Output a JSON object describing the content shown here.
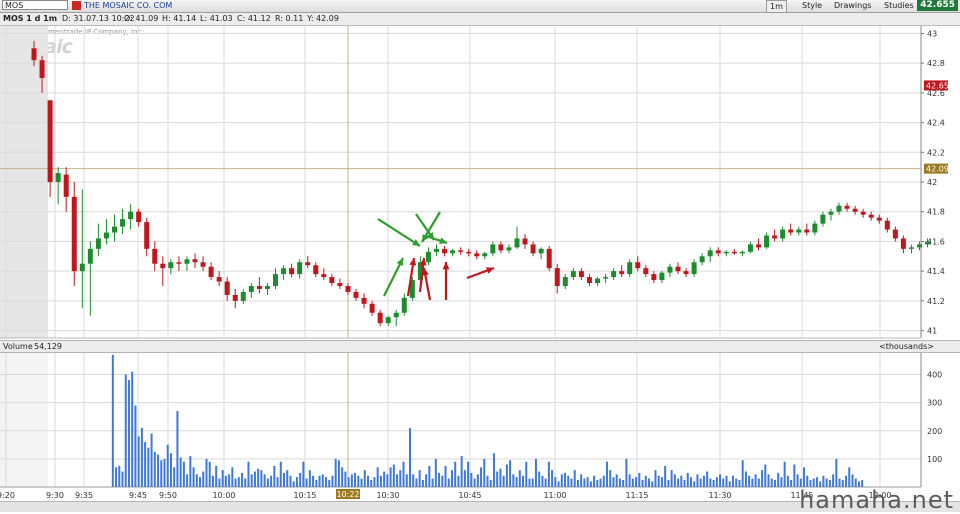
{
  "toolbar": {
    "symbol": "MOS",
    "company": "THE MOSAIC CO. COM",
    "interval": "1m",
    "style": "Style",
    "drawings": "Drawings",
    "studies": "Studies",
    "last_price": "42.655"
  },
  "info": {
    "chart_label": "MOS 1 d 1m",
    "date": "D: 31.07.13 10:22",
    "open": "O: 41.09",
    "high": "H: 41.14",
    "low": "L: 41.03",
    "close": "C: 41.12",
    "range": "R: 0.11",
    "y": "Y: 42.09"
  },
  "watermark": {
    "copyright": "2013 © TD Ameritrade IP Company, Inc.",
    "logo": "Mosaic"
  },
  "volume_panel": {
    "label": "Volume",
    "value": "54,129",
    "units": "<thousands>"
  },
  "site_watermark": "hamaha.net",
  "colors": {
    "up": "#1e8c2e",
    "down": "#c0171d",
    "volume": "#3e78d8",
    "grid": "#d9d9d9",
    "crosshair": "#c8b48a",
    "arrow_green": "#2e9e2e",
    "arrow_red": "#c0171d"
  },
  "chart_data": [
    {
      "type": "candlestick",
      "title": "MOS 1 d 1m",
      "ylim": [
        40.95,
        43.05
      ],
      "y_ticks": [
        "43",
        "42.8",
        "42.6",
        "42.4",
        "42.2",
        "42",
        "41.8",
        "41.6",
        "41.4",
        "41.2",
        "41"
      ],
      "x_ticks": [
        "9:20",
        "9:30",
        "9:35",
        "9:45",
        "9:50",
        "10:00",
        "10:15",
        "10:30",
        "10:45",
        "11:00",
        "11:15",
        "11:30",
        "11:45",
        "12:00"
      ],
      "price_markers": [
        {
          "label": "42.65",
          "value": 42.65,
          "color": "#c0171d"
        },
        {
          "label": "42.09",
          "value": 42.09,
          "color": "#9b7a1e"
        }
      ],
      "crosshair": {
        "time": "10:22",
        "price": 42.09
      },
      "ohlc": [
        [
          42.9,
          42.95,
          42.78,
          42.82
        ],
        [
          42.82,
          42.85,
          42.6,
          42.7
        ],
        [
          42.55,
          42.55,
          41.9,
          42.0
        ],
        [
          42.0,
          42.1,
          41.85,
          42.06
        ],
        [
          42.05,
          42.1,
          41.8,
          41.9
        ],
        [
          41.9,
          42.0,
          41.3,
          41.4
        ],
        [
          41.4,
          41.95,
          41.15,
          41.45
        ],
        [
          41.45,
          41.6,
          41.1,
          41.55
        ],
        [
          41.55,
          41.72,
          41.5,
          41.62
        ],
        [
          41.62,
          41.75,
          41.58,
          41.66
        ],
        [
          41.66,
          41.78,
          41.6,
          41.7
        ],
        [
          41.7,
          41.82,
          41.65,
          41.75
        ],
        [
          41.75,
          41.85,
          41.68,
          41.8
        ],
        [
          41.8,
          41.82,
          41.7,
          41.73
        ],
        [
          41.73,
          41.76,
          41.5,
          41.55
        ],
        [
          41.55,
          41.6,
          41.4,
          41.45
        ],
        [
          41.45,
          41.5,
          41.3,
          41.42
        ],
        [
          41.42,
          41.48,
          41.38,
          41.46
        ],
        [
          41.46,
          41.5,
          41.4,
          41.45
        ],
        [
          41.45,
          41.5,
          41.4,
          41.48
        ],
        [
          41.48,
          41.52,
          41.42,
          41.46
        ],
        [
          41.46,
          41.5,
          41.4,
          41.43
        ],
        [
          41.43,
          41.46,
          41.34,
          41.36
        ],
        [
          41.36,
          41.4,
          41.3,
          41.33
        ],
        [
          41.33,
          41.36,
          41.2,
          41.24
        ],
        [
          41.24,
          41.28,
          41.15,
          41.2
        ],
        [
          41.2,
          41.28,
          41.18,
          41.26
        ],
        [
          41.26,
          41.32,
          41.22,
          41.3
        ],
        [
          41.3,
          41.36,
          41.25,
          41.28
        ],
        [
          41.28,
          41.32,
          41.24,
          41.3
        ],
        [
          41.3,
          41.42,
          41.28,
          41.38
        ],
        [
          41.38,
          41.44,
          41.34,
          41.42
        ],
        [
          41.42,
          41.45,
          41.36,
          41.38
        ],
        [
          41.38,
          41.48,
          41.35,
          41.46
        ],
        [
          41.46,
          41.5,
          41.42,
          41.44
        ],
        [
          41.44,
          41.46,
          41.36,
          41.38
        ],
        [
          41.38,
          41.42,
          41.34,
          41.36
        ],
        [
          41.36,
          41.38,
          41.3,
          41.32
        ],
        [
          41.32,
          41.35,
          41.28,
          41.3
        ],
        [
          41.3,
          41.32,
          41.24,
          41.26
        ],
        [
          41.26,
          41.28,
          41.2,
          41.22
        ],
        [
          41.22,
          41.25,
          41.15,
          41.18
        ],
        [
          41.18,
          41.2,
          41.1,
          41.12
        ],
        [
          41.12,
          41.14,
          41.03,
          41.05
        ],
        [
          41.05,
          41.1,
          41.03,
          41.09
        ],
        [
          41.09,
          41.14,
          41.03,
          41.12
        ],
        [
          41.12,
          41.25,
          41.1,
          41.22
        ],
        [
          41.22,
          41.36,
          41.2,
          41.34
        ],
        [
          41.34,
          41.5,
          41.32,
          41.46
        ],
        [
          41.46,
          41.56,
          41.44,
          41.53
        ],
        [
          41.53,
          41.58,
          41.5,
          41.55
        ],
        [
          41.55,
          41.57,
          41.5,
          41.52
        ],
        [
          41.52,
          41.55,
          41.5,
          41.54
        ],
        [
          41.54,
          41.56,
          41.51,
          41.53
        ],
        [
          41.53,
          41.55,
          41.5,
          41.52
        ],
        [
          41.52,
          41.54,
          41.48,
          41.5
        ],
        [
          41.5,
          41.53,
          41.48,
          41.52
        ],
        [
          41.52,
          41.6,
          41.5,
          41.58
        ],
        [
          41.58,
          41.6,
          41.52,
          41.54
        ],
        [
          41.54,
          41.58,
          41.52,
          41.56
        ],
        [
          41.56,
          41.7,
          41.55,
          41.62
        ],
        [
          41.62,
          41.65,
          41.55,
          41.58
        ],
        [
          41.58,
          41.6,
          41.5,
          41.52
        ],
        [
          41.52,
          41.56,
          41.48,
          41.55
        ],
        [
          41.55,
          41.57,
          41.4,
          41.42
        ],
        [
          41.42,
          41.45,
          41.25,
          41.3
        ],
        [
          41.3,
          41.38,
          41.28,
          41.36
        ],
        [
          41.36,
          41.42,
          41.34,
          41.4
        ],
        [
          41.4,
          41.42,
          41.34,
          41.36
        ],
        [
          41.36,
          41.38,
          41.3,
          41.32
        ],
        [
          41.32,
          41.36,
          41.3,
          41.35
        ],
        [
          41.35,
          41.38,
          41.32,
          41.36
        ],
        [
          41.36,
          41.42,
          41.34,
          41.4
        ],
        [
          41.4,
          41.44,
          41.36,
          41.38
        ],
        [
          41.38,
          41.48,
          41.36,
          41.46
        ],
        [
          41.46,
          41.5,
          41.4,
          41.42
        ],
        [
          41.42,
          41.44,
          41.36,
          41.38
        ],
        [
          41.38,
          41.4,
          41.32,
          41.34
        ],
        [
          41.34,
          41.4,
          41.32,
          41.39
        ],
        [
          41.39,
          41.45,
          41.36,
          41.43
        ],
        [
          41.43,
          41.46,
          41.38,
          41.4
        ],
        [
          41.4,
          41.42,
          41.36,
          41.38
        ],
        [
          41.38,
          41.48,
          41.36,
          41.46
        ],
        [
          41.46,
          41.52,
          41.44,
          41.5
        ],
        [
          41.5,
          41.56,
          41.46,
          41.54
        ],
        [
          41.54,
          41.56,
          41.5,
          41.52
        ],
        [
          41.52,
          41.54,
          41.5,
          41.53
        ],
        [
          41.53,
          41.55,
          41.51,
          41.52
        ],
        [
          41.52,
          41.54,
          41.5,
          41.53
        ],
        [
          41.53,
          41.6,
          41.52,
          41.58
        ],
        [
          41.58,
          41.62,
          41.54,
          41.56
        ],
        [
          41.56,
          41.66,
          41.55,
          41.64
        ],
        [
          41.64,
          41.68,
          41.6,
          41.62
        ],
        [
          41.62,
          41.7,
          41.6,
          41.68
        ],
        [
          41.68,
          41.72,
          41.64,
          41.66
        ],
        [
          41.66,
          41.7,
          41.64,
          41.68
        ],
        [
          41.68,
          41.72,
          41.64,
          41.66
        ],
        [
          41.66,
          41.74,
          41.64,
          41.72
        ],
        [
          41.72,
          41.8,
          41.7,
          41.78
        ],
        [
          41.78,
          41.82,
          41.74,
          41.8
        ],
        [
          41.8,
          41.86,
          41.78,
          41.84
        ],
        [
          41.84,
          41.86,
          41.8,
          41.82
        ],
        [
          41.82,
          41.84,
          41.78,
          41.8
        ],
        [
          41.8,
          41.82,
          41.76,
          41.78
        ],
        [
          41.78,
          41.8,
          41.74,
          41.76
        ],
        [
          41.76,
          41.78,
          41.72,
          41.74
        ],
        [
          41.74,
          41.76,
          41.66,
          41.68
        ],
        [
          41.68,
          41.7,
          41.6,
          41.62
        ],
        [
          41.62,
          41.64,
          41.52,
          41.55
        ],
        [
          41.55,
          41.58,
          41.52,
          41.56
        ],
        [
          41.56,
          41.6,
          41.54,
          41.58
        ],
        [
          41.58,
          41.62,
          41.56,
          41.6
        ]
      ]
    },
    {
      "type": "bar",
      "title": "Volume",
      "units": "thousands",
      "ylim": [
        0,
        480
      ],
      "y_ticks": [
        "400",
        "300",
        "200",
        "100"
      ],
      "values": [
        0,
        0,
        0,
        0,
        0,
        0,
        0,
        0,
        0,
        0,
        0,
        0,
        0,
        0,
        0,
        0,
        0,
        0,
        0,
        0,
        0,
        0,
        0,
        0,
        0,
        0,
        0,
        0,
        0,
        0,
        0,
        0,
        0,
        0,
        470,
        70,
        75,
        55,
        400,
        380,
        410,
        290,
        180,
        210,
        160,
        140,
        190,
        125,
        115,
        95,
        100,
        150,
        120,
        70,
        270,
        105,
        90,
        45,
        110,
        70,
        45,
        35,
        55,
        100,
        90,
        40,
        75,
        30,
        60,
        40,
        45,
        70,
        30,
        35,
        50,
        30,
        90,
        45,
        55,
        65,
        60,
        45,
        30,
        40,
        75,
        35,
        90,
        50,
        60,
        40,
        20,
        35,
        50,
        90,
        30,
        60,
        40,
        25,
        40,
        45,
        35,
        25,
        40,
        100,
        95,
        70,
        55,
        35,
        45,
        50,
        40,
        30,
        60,
        40,
        25,
        35,
        70,
        40,
        55,
        45,
        70,
        80,
        45,
        60,
        90,
        45,
        210,
        45,
        30,
        60,
        25,
        45,
        75,
        30,
        100,
        50,
        40,
        75,
        30,
        60,
        90,
        40,
        110,
        60,
        90,
        50,
        30,
        45,
        70,
        100,
        40,
        25,
        120,
        55,
        65,
        40,
        80,
        95,
        45,
        35,
        60,
        40,
        90,
        30,
        30,
        100,
        55,
        40,
        30,
        90,
        60,
        35,
        20,
        45,
        50,
        40,
        30,
        60,
        25,
        45,
        30,
        35,
        20,
        40,
        25,
        30,
        40,
        90,
        60,
        35,
        45,
        30,
        25,
        100,
        45,
        30,
        35,
        50,
        25,
        40,
        30,
        20,
        60,
        40,
        35,
        75,
        25,
        60,
        45,
        30,
        40,
        25,
        50,
        35,
        20,
        45,
        30,
        40,
        55,
        30,
        25,
        35,
        45,
        30,
        40,
        20,
        40,
        30,
        25,
        95,
        55,
        40,
        30,
        45,
        30,
        60,
        80,
        45,
        30,
        25,
        50,
        35,
        90,
        40,
        25,
        80,
        45,
        30,
        70,
        40,
        25,
        30,
        35,
        20,
        40,
        30,
        25,
        45,
        100,
        30,
        25,
        40,
        70,
        45,
        30,
        20,
        25
      ]
    }
  ]
}
